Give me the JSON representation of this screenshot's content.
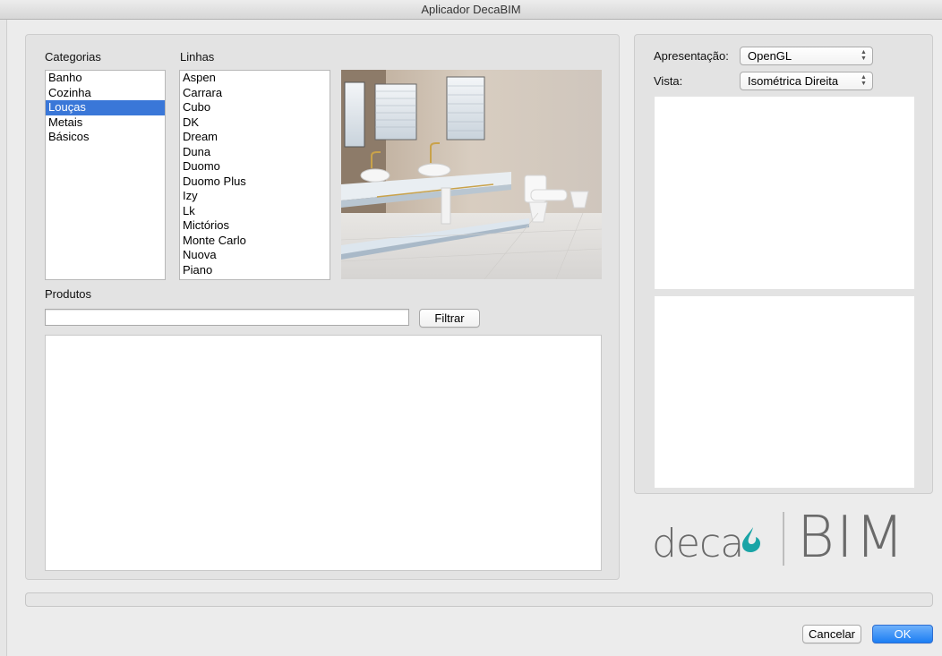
{
  "window": {
    "title": "Aplicador DecaBIM"
  },
  "categorias": {
    "label": "Categorias",
    "items": [
      "Banho",
      "Cozinha",
      "Louças",
      "Metais",
      "Básicos"
    ],
    "selected": "Louças"
  },
  "linhas": {
    "label": "Linhas",
    "items": [
      "Aspen",
      "Carrara",
      "Cubo",
      "DK",
      "Dream",
      "Duna",
      "Duomo",
      "Duomo Plus",
      "Izy",
      "Lk",
      "Mictórios",
      "Monte Carlo",
      "Nuova",
      "Piano"
    ]
  },
  "produtos": {
    "label": "Produtos",
    "filter_value": "",
    "filter_button": "Filtrar"
  },
  "view_options": {
    "apresentacao_label": "Apresentação:",
    "apresentacao_value": "OpenGL",
    "vista_label": "Vista:",
    "vista_value": "Isométrica Direita"
  },
  "logo": {
    "left_text": "deca",
    "right_text": "BIM"
  },
  "footer": {
    "cancel_label": "Cancelar",
    "ok_label": "OK"
  },
  "colors": {
    "selection": "#3a77d8",
    "ok_button": "#1c7ef3",
    "logo_accent": "#1aa4a6"
  }
}
